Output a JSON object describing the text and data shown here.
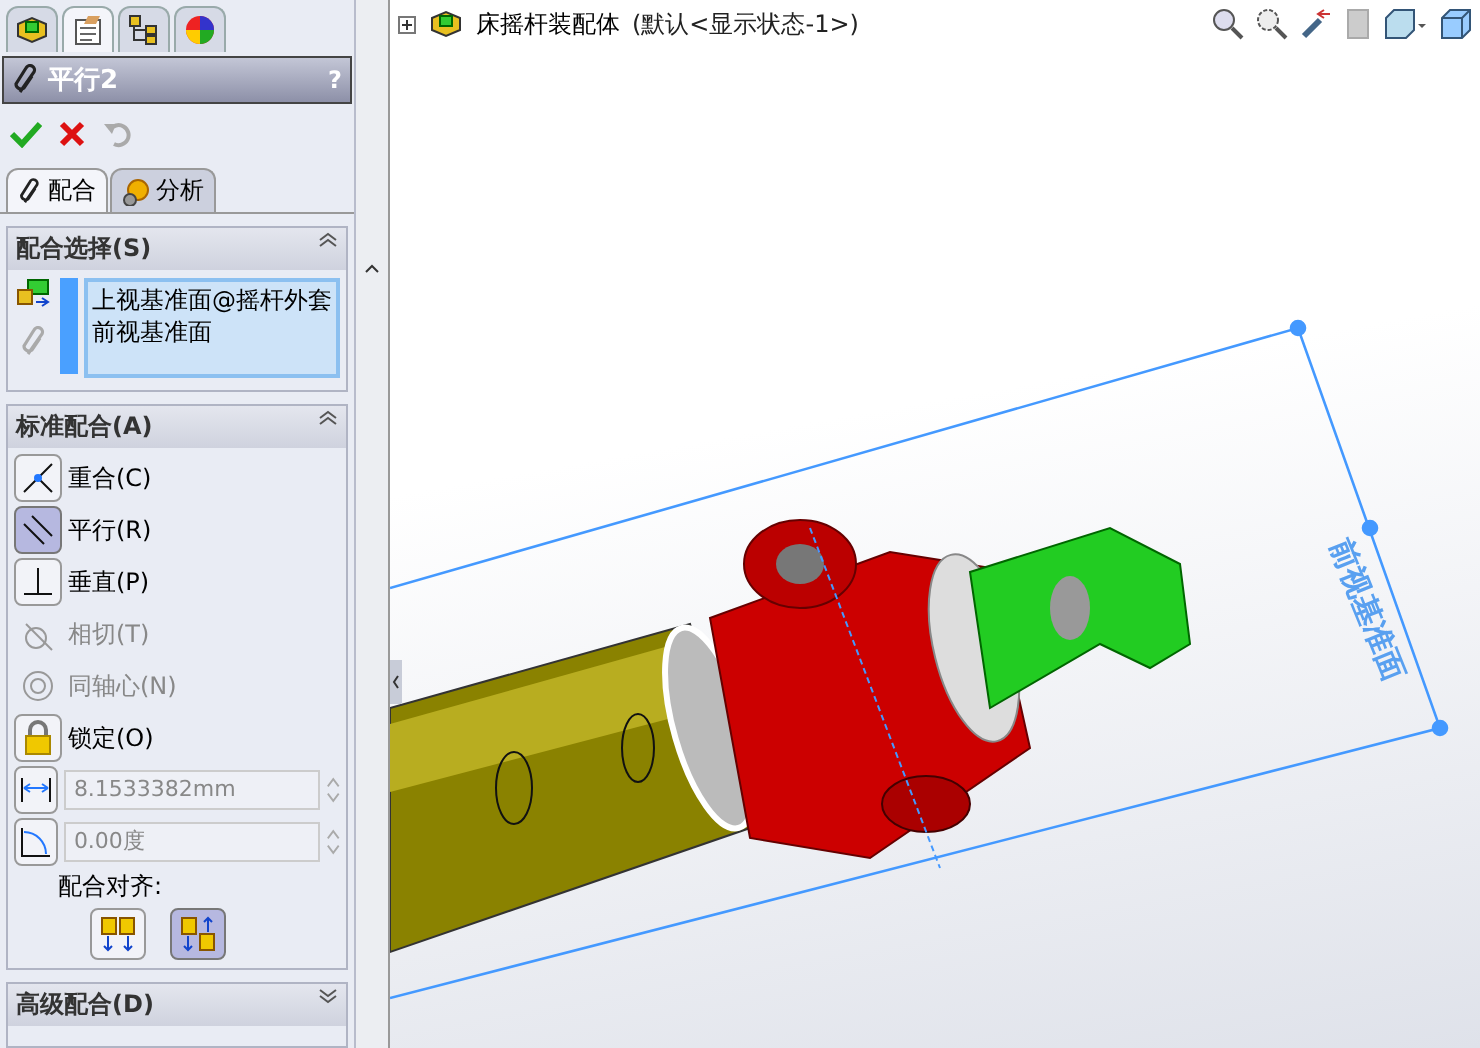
{
  "manager_tabs": [
    {
      "kind": "feature",
      "selected": false
    },
    {
      "kind": "property",
      "selected": true
    },
    {
      "kind": "config",
      "selected": false
    },
    {
      "kind": "appearance",
      "selected": false
    }
  ],
  "panel": {
    "title": "平行2",
    "help": "?"
  },
  "subtabs": [
    {
      "label": "配合",
      "kind": "mate",
      "selected": true
    },
    {
      "label": "分析",
      "kind": "analysis",
      "selected": false
    }
  ],
  "mate_selections": {
    "title": "配合选择(S)",
    "items": [
      "上视基准面@摇杆外套",
      "前视基准面"
    ]
  },
  "standard_mates": {
    "title": "标准配合(A)",
    "items": [
      {
        "label": "重合(C)",
        "kind": "coincident",
        "selected": false,
        "disabled": false
      },
      {
        "label": "平行(R)",
        "kind": "parallel",
        "selected": true,
        "disabled": false
      },
      {
        "label": "垂直(P)",
        "kind": "perpendicular",
        "selected": false,
        "disabled": false
      },
      {
        "label": "相切(T)",
        "kind": "tangent",
        "selected": false,
        "disabled": true
      },
      {
        "label": "同轴心(N)",
        "kind": "concentric",
        "selected": false,
        "disabled": true
      },
      {
        "label": "锁定(O)",
        "kind": "lock",
        "selected": false,
        "disabled": false
      }
    ],
    "distance": {
      "value": "8.1533382mm",
      "disabled": true
    },
    "angle": {
      "value": "0.00度",
      "disabled": true
    },
    "alignment_label": "配合对齐:",
    "alignment": [
      {
        "kind": "aligned",
        "selected": false
      },
      {
        "kind": "anti",
        "selected": true
      }
    ]
  },
  "advanced_mates": {
    "title": "高级配合(D)"
  },
  "viewport": {
    "tree_root": "床摇杆装配体",
    "config": "(默认<显示状态-1>)",
    "plane_label": "前视基准面"
  }
}
